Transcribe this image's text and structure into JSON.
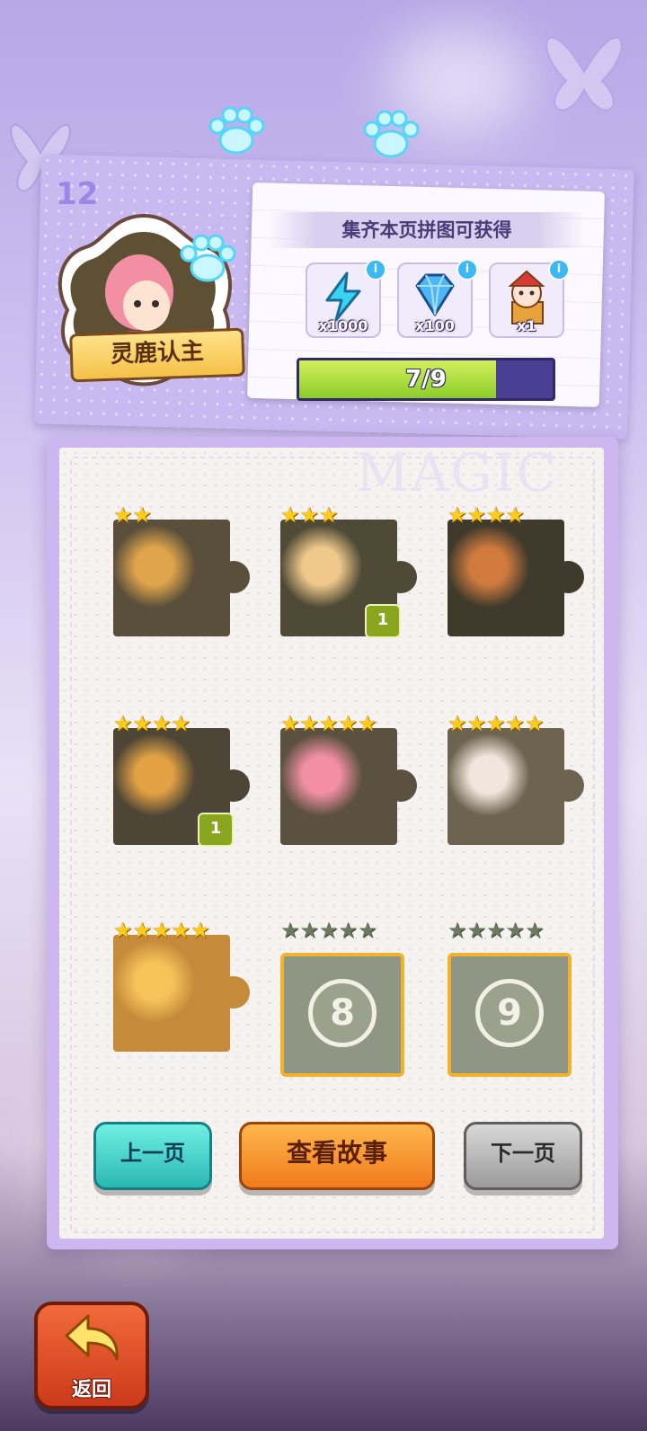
{
  "header": {
    "page_number": "12",
    "badge_label": "灵鹿认主",
    "reward_title": "集齐本页拼图可获得",
    "rewards": [
      {
        "icon": "energy-bolt-icon",
        "qty": "x1000",
        "info": "i"
      },
      {
        "icon": "diamond-icon",
        "qty": "x100",
        "info": "i"
      },
      {
        "icon": "jester-character-icon",
        "qty": "x1",
        "info": "i"
      }
    ],
    "progress": {
      "text": "7/9",
      "collected": 7,
      "total": 9
    }
  },
  "board": {
    "watermark": "MAGIC",
    "pieces": [
      {
        "stars": 2,
        "max_stars": 2,
        "unlocked": true,
        "count": ""
      },
      {
        "stars": 3,
        "max_stars": 3,
        "unlocked": true,
        "count": "1"
      },
      {
        "stars": 4,
        "max_stars": 4,
        "unlocked": true,
        "count": ""
      },
      {
        "stars": 4,
        "max_stars": 4,
        "unlocked": true,
        "count": "1"
      },
      {
        "stars": 5,
        "max_stars": 5,
        "unlocked": true,
        "count": ""
      },
      {
        "stars": 5,
        "max_stars": 5,
        "unlocked": true,
        "count": ""
      },
      {
        "stars": 5,
        "max_stars": 5,
        "unlocked": true,
        "count": ""
      },
      {
        "stars": 0,
        "max_stars": 5,
        "unlocked": false,
        "number": "8"
      },
      {
        "stars": 0,
        "max_stars": 5,
        "unlocked": false,
        "number": "9"
      }
    ]
  },
  "buttons": {
    "prev": "上一页",
    "story": "查看故事",
    "next": "下一页",
    "back": "返回"
  },
  "colors": {
    "gold_star": "#ffcc1a",
    "progress_fill": "#8ccd2a",
    "prev_button": "#2bb8b2",
    "story_button": "#f07a1c",
    "next_button": "#9b9b9b",
    "back_button": "#cc3a1a"
  }
}
